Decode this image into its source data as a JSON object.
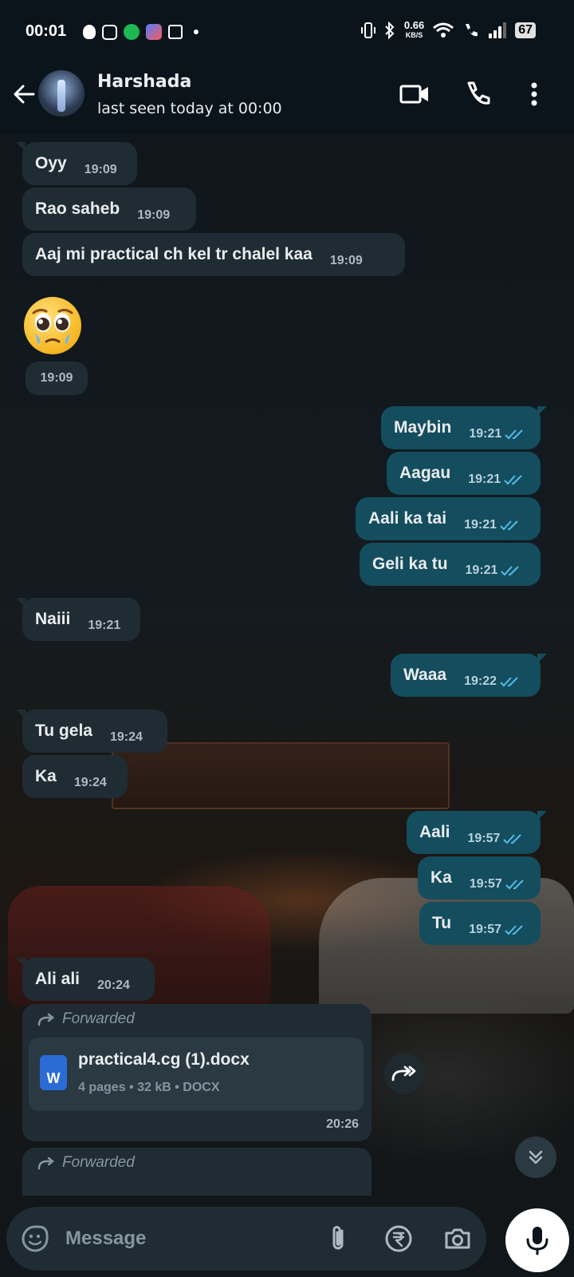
{
  "status_bar": {
    "time": "00:01",
    "speed_value": "0.66",
    "speed_unit": "KB/S",
    "battery": "67"
  },
  "header": {
    "contact_name": "Harshada",
    "contact_status": "last seen today at 00:00"
  },
  "messages": [
    {
      "dir": "in",
      "text": "Oyy",
      "time": "19:09"
    },
    {
      "dir": "in",
      "text": "Rao saheb",
      "time": "19:09"
    },
    {
      "dir": "in",
      "text": "Aaj mi practical ch kel tr chalel kaa",
      "time": "19:09"
    },
    {
      "dir": "in",
      "text": "🥹",
      "time": "19:09"
    },
    {
      "dir": "out",
      "text": "Maybin",
      "time": "19:21"
    },
    {
      "dir": "out",
      "text": "Aagau",
      "time": "19:21"
    },
    {
      "dir": "out",
      "text": "Aali ka tai",
      "time": "19:21"
    },
    {
      "dir": "out",
      "text": "Geli ka tu",
      "time": "19:21"
    },
    {
      "dir": "in",
      "text": "Naiii",
      "time": "19:21"
    },
    {
      "dir": "out",
      "text": "Waaa",
      "time": "19:22"
    },
    {
      "dir": "in",
      "text": "Tu gela",
      "time": "19:24"
    },
    {
      "dir": "in",
      "text": "Ka",
      "time": "19:24"
    },
    {
      "dir": "out",
      "text": "Aali",
      "time": "19:57"
    },
    {
      "dir": "out",
      "text": "Ka",
      "time": "19:57"
    },
    {
      "dir": "out",
      "text": "Tu",
      "time": "19:57"
    },
    {
      "dir": "in",
      "text": "Ali ali",
      "time": "20:24"
    }
  ],
  "document_message": {
    "forwarded_label": "Forwarded",
    "file_name": "practical4.cg (1).docx",
    "file_meta": "4 pages • 32 kB • DOCX",
    "file_icon_letter": "W",
    "time": "20:26"
  },
  "second_forward": {
    "forwarded_label": "Forwarded"
  },
  "input_bar": {
    "placeholder": "Message"
  },
  "colors": {
    "incoming_bubble": "#202c33",
    "outgoing_bubble": "#144d5e",
    "read_ticks": "#53bdeb",
    "background": "#0b141a"
  }
}
